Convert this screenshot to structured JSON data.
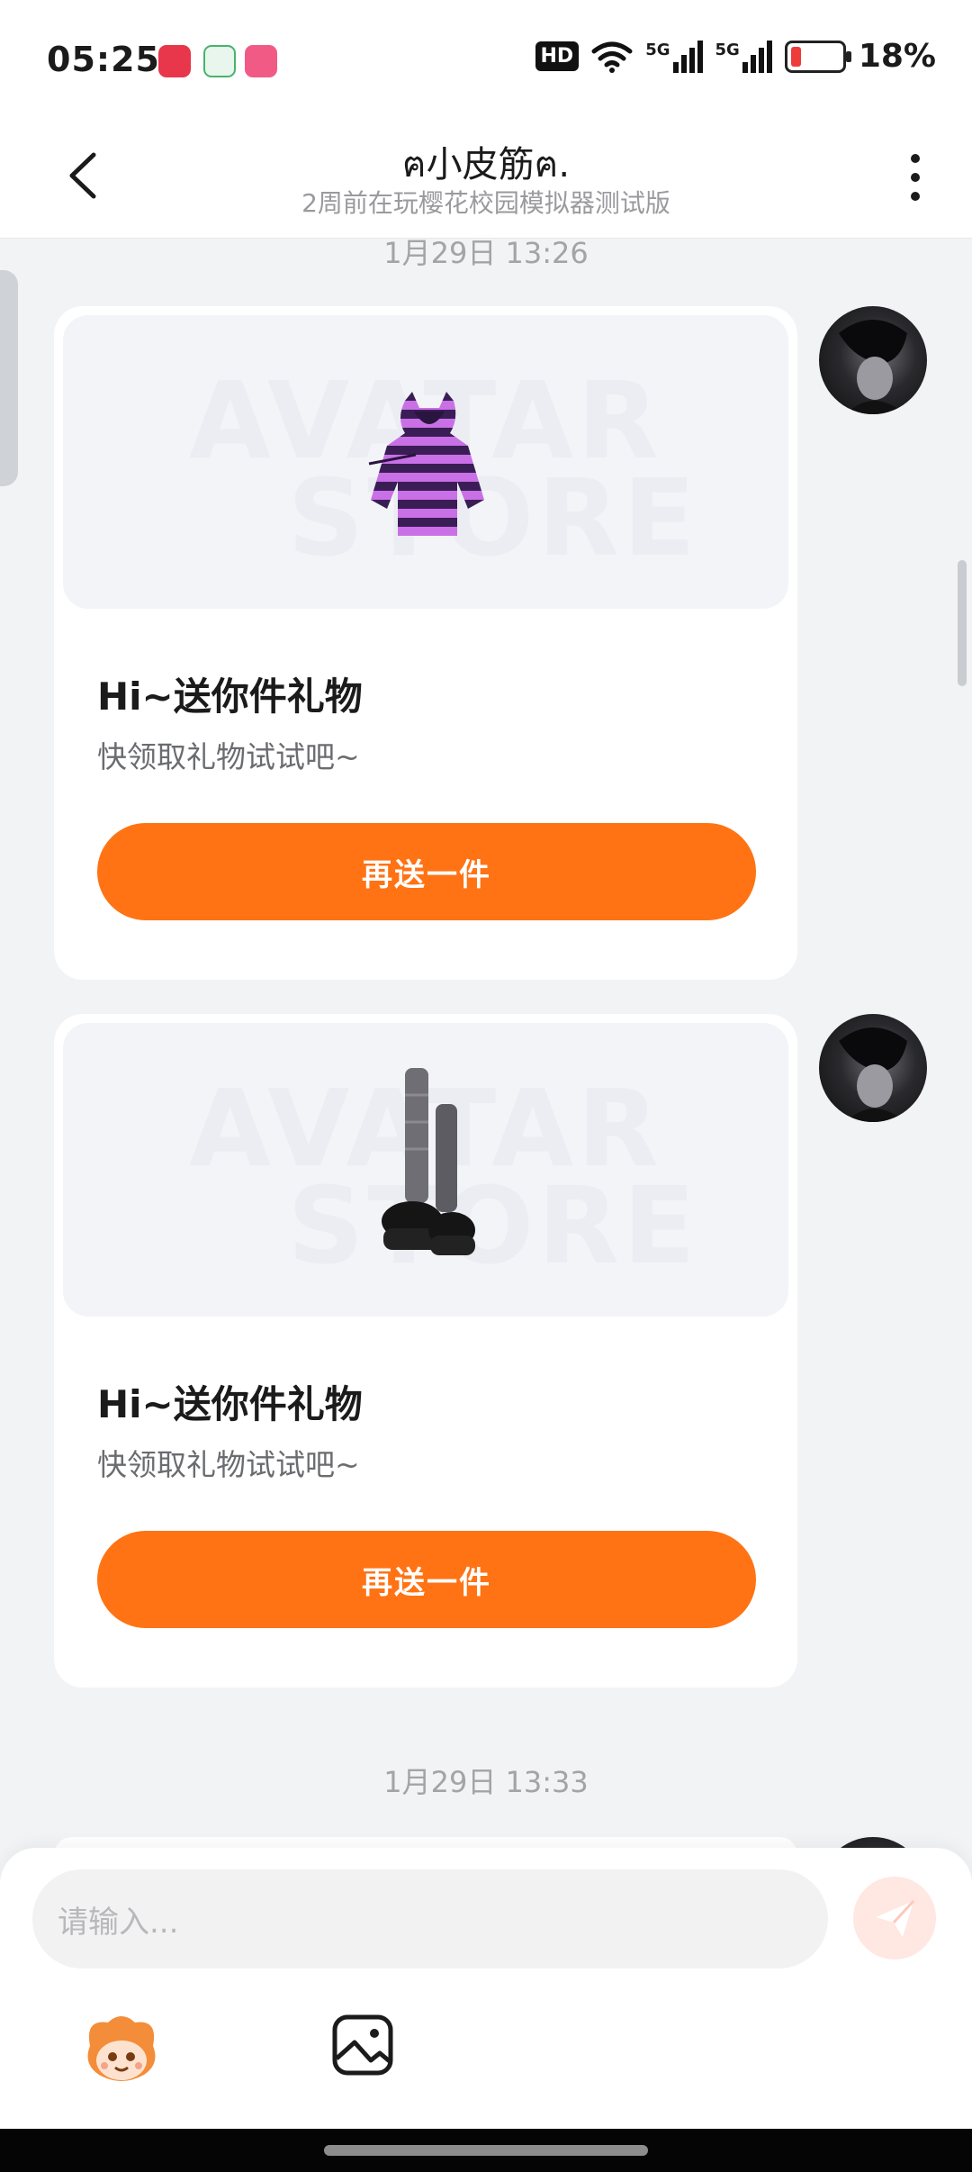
{
  "status_bar": {
    "time": "05:25",
    "hd_badge": "HD",
    "network": "5G",
    "battery_percent": "18%",
    "battery_level": 0.18
  },
  "header": {
    "title": "ฅ小皮筋ฅ.",
    "subtitle": "2周前在玩樱花校园模拟器测试版"
  },
  "messages": [
    {
      "timestamp": "1月29日 13:26",
      "title": "Hi~送你件礼物",
      "subtitle": "快领取礼物试试吧~",
      "button": "再送一件",
      "watermark_line1": "AVATAR",
      "watermark_line2": "STORE",
      "item_icon": "purple-striped-hoodie-icon"
    },
    {
      "title": "Hi~送你件礼物",
      "subtitle": "快领取礼物试试吧~",
      "button": "再送一件",
      "watermark_line1": "AVATAR",
      "watermark_line2": "STORE",
      "item_icon": "grey-socks-platform-shoes-icon"
    }
  ],
  "timestamp2": "1月29日 13:33",
  "input": {
    "placeholder": "请输入..."
  },
  "colors": {
    "accent": "#ff7314",
    "background": "#f2f3f5",
    "card": "#ffffff"
  }
}
